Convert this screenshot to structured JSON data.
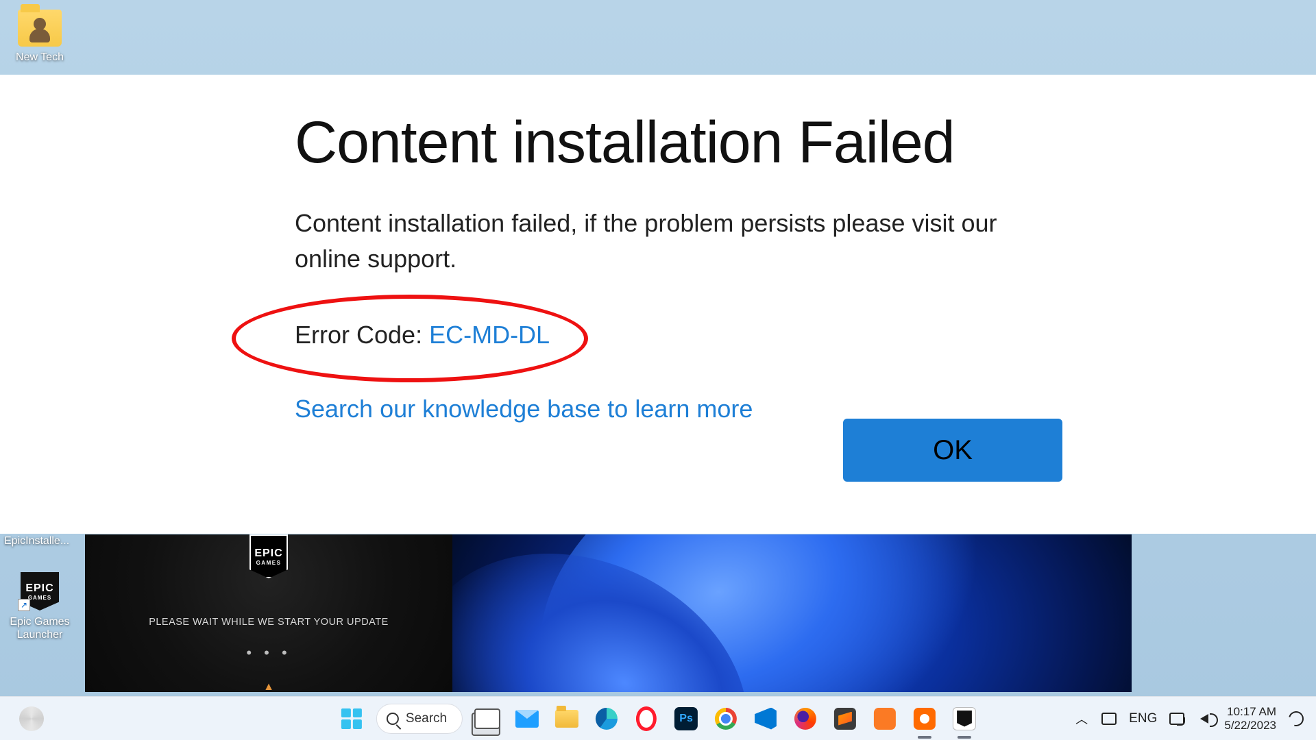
{
  "desktop": {
    "icons": {
      "new_tech": {
        "label": "New Tech"
      },
      "epic_installer": {
        "label": "EpicInstalle..."
      },
      "epic_launcher": {
        "label": "Epic Games\nLauncher"
      }
    }
  },
  "epic_splash": {
    "logo_line1": "EPIC",
    "logo_line2": "GAMES",
    "message": "PLEASE WAIT WHILE WE START YOUR UPDATE",
    "dots": "• • •",
    "warn_glyph": "▲"
  },
  "dialog": {
    "title": "Content installation Failed",
    "body": "Content installation failed, if the problem persists please visit our online support.",
    "error_label": "Error Code: ",
    "error_code": "EC-MD-DL",
    "kb_link": "Search our knowledge base to learn more",
    "ok": "OK"
  },
  "taskbar": {
    "search_label": "Search",
    "ps_label": "Ps",
    "xampp_label": "",
    "lang": "ENG",
    "time": "10:17 AM",
    "date": "5/22/2023"
  }
}
